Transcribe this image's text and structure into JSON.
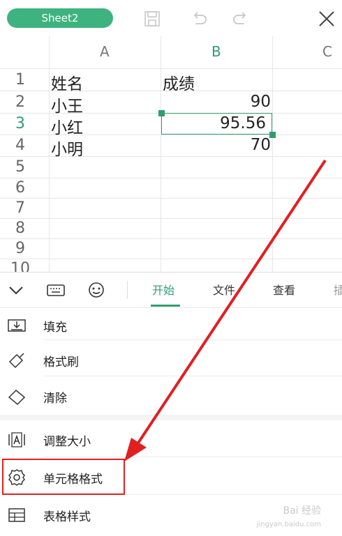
{
  "topbar": {
    "sheet_name": "Sheet2",
    "icons": [
      "save-icon",
      "undo-icon",
      "redo-icon",
      "close-icon"
    ]
  },
  "columns": [
    "A",
    "B",
    "C"
  ],
  "rows": [
    {
      "num": "1",
      "a": "姓名",
      "b": "成绩"
    },
    {
      "num": "2",
      "a": "小王",
      "b": "90"
    },
    {
      "num": "3",
      "a": "小红",
      "b": "95.56"
    },
    {
      "num": "4",
      "a": "小明",
      "b": "70"
    },
    {
      "num": "5",
      "a": "",
      "b": ""
    },
    {
      "num": "6",
      "a": "",
      "b": ""
    },
    {
      "num": "7",
      "a": "",
      "b": ""
    },
    {
      "num": "8",
      "a": "",
      "b": ""
    },
    {
      "num": "9",
      "a": "",
      "b": ""
    },
    {
      "num": "10",
      "a": "",
      "b": ""
    }
  ],
  "selection": {
    "cell": "B3",
    "accent": "#2f9e6f"
  },
  "toolbar": {
    "tabs": [
      {
        "label": "开始",
        "active": true
      },
      {
        "label": "文件",
        "active": false
      },
      {
        "label": "查看",
        "active": false
      },
      {
        "label": "插",
        "active": false
      }
    ]
  },
  "menu": {
    "items": [
      {
        "label": "填充",
        "icon": "fill-icon"
      },
      {
        "label": "格式刷",
        "icon": "format-painter-icon"
      },
      {
        "label": "清除",
        "icon": "eraser-icon"
      },
      {
        "label": "调整大小",
        "icon": "resize-icon"
      },
      {
        "label": "单元格格式",
        "icon": "gear-icon"
      },
      {
        "label": "表格样式",
        "icon": "table-style-icon"
      }
    ]
  },
  "highlight_color": "#e02020",
  "watermark": {
    "text": "Bai 经验",
    "sub": "jingyan.baidu.com"
  }
}
